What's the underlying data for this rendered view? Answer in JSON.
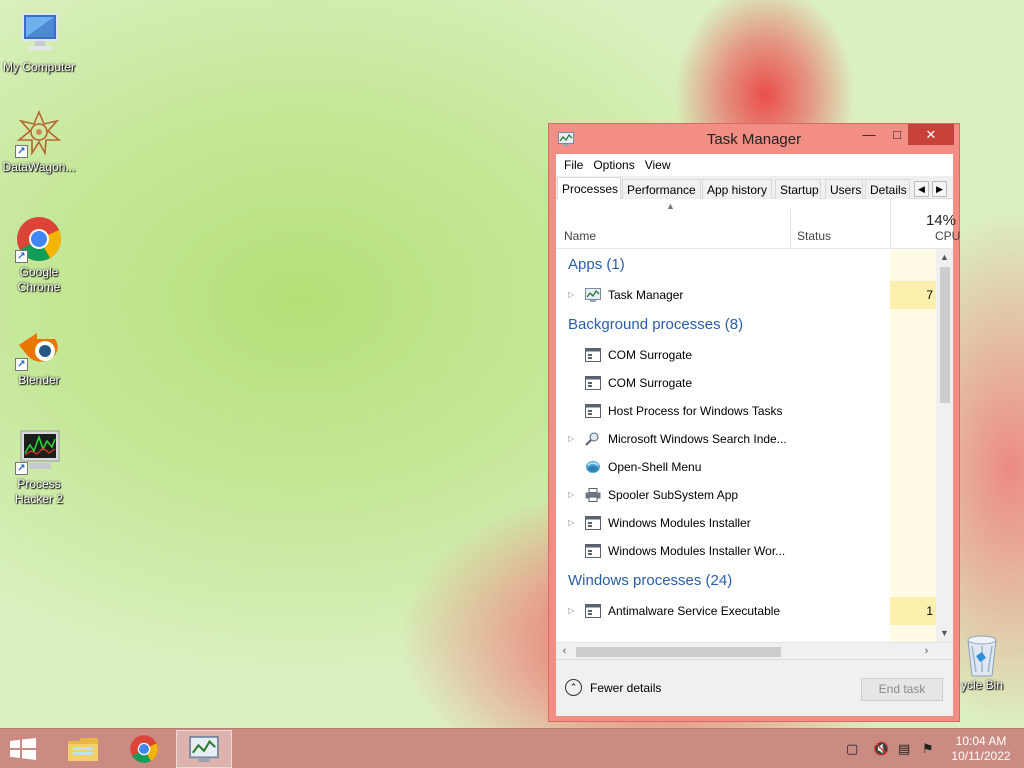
{
  "desktop": {
    "icons": [
      {
        "label": "My Computer",
        "icon": "computer-icon"
      },
      {
        "label": "DataWagon...",
        "icon": "datawagon-icon"
      },
      {
        "label": "Google Chrome",
        "icon": "chrome-icon"
      },
      {
        "label": "Blender",
        "icon": "blender-icon"
      },
      {
        "label": "Process Hacker 2",
        "icon": "process-hacker-icon"
      }
    ],
    "recycle_bin": {
      "label": "ycle Bin",
      "icon": "recycle-bin-icon"
    }
  },
  "task_manager": {
    "title": "Task Manager",
    "menu": [
      "File",
      "Options",
      "View"
    ],
    "tabs": [
      "Processes",
      "Performance",
      "App history",
      "Startup",
      "Users",
      "Details"
    ],
    "active_tab": "Processes",
    "columns": {
      "name": "Name",
      "status": "Status",
      "cpu_pct": "14%",
      "cpu": "CPU"
    },
    "groups": [
      {
        "label": "Apps (1)",
        "rows": [
          {
            "name": "Task Manager",
            "expandable": true,
            "icon": "task-manager-icon",
            "cpu": "7",
            "highlight": true
          }
        ]
      },
      {
        "label": "Background processes (8)",
        "rows": [
          {
            "name": "COM Surrogate",
            "expandable": false,
            "icon": "window-process-icon",
            "cpu": "",
            "highlight": false
          },
          {
            "name": "COM Surrogate",
            "expandable": false,
            "icon": "window-process-icon",
            "cpu": "",
            "highlight": false
          },
          {
            "name": "Host Process for Windows Tasks",
            "expandable": false,
            "icon": "window-process-icon",
            "cpu": "",
            "highlight": false
          },
          {
            "name": "Microsoft Windows Search Inde...",
            "expandable": true,
            "icon": "search-indexer-icon",
            "cpu": "",
            "highlight": false
          },
          {
            "name": "Open-Shell Menu",
            "expandable": false,
            "icon": "open-shell-icon",
            "cpu": "",
            "highlight": false
          },
          {
            "name": "Spooler SubSystem App",
            "expandable": true,
            "icon": "printer-icon",
            "cpu": "",
            "highlight": false
          },
          {
            "name": "Windows Modules Installer",
            "expandable": true,
            "icon": "window-process-icon",
            "cpu": "",
            "highlight": false
          },
          {
            "name": "Windows Modules Installer Wor...",
            "expandable": false,
            "icon": "window-process-icon",
            "cpu": "",
            "highlight": false
          }
        ]
      },
      {
        "label": "Windows processes (24)",
        "rows": [
          {
            "name": "Antimalware Service Executable",
            "expandable": true,
            "icon": "window-process-icon",
            "cpu": "1",
            "highlight": true
          }
        ]
      }
    ],
    "footer": {
      "fewer_details": "Fewer details",
      "end_task": "End task"
    }
  },
  "taskbar": {
    "apps": [
      "file-explorer-icon",
      "chrome-icon",
      "task-manager-icon"
    ],
    "tray_icons": [
      "action-center-icon",
      "volume-muted-icon",
      "network-icon",
      "flag-error-icon"
    ],
    "time": "10:04 AM",
    "date": "10/11/2022"
  }
}
